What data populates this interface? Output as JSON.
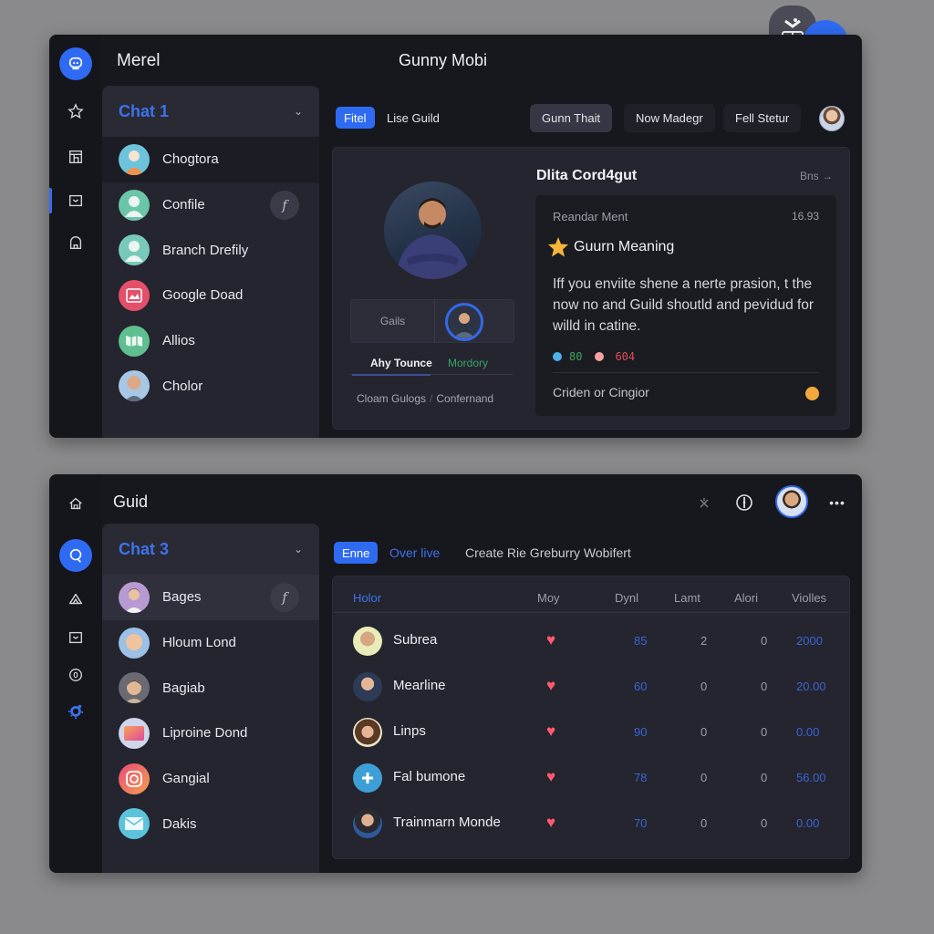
{
  "window1": {
    "title_left": "Merel",
    "title_center": "Gunny Mobi",
    "rail_icons": [
      "app-logo-icon",
      "star-icon",
      "layout-icon",
      "inbox-icon",
      "contacts-icon"
    ],
    "chat_panel": {
      "title": "Chat 1",
      "items": [
        {
          "name": "Chogtora",
          "avatar": "person-orange"
        },
        {
          "name": "Confile",
          "avatar": "person-teal",
          "action": "f"
        },
        {
          "name": "Branch Drefily",
          "avatar": "person-teal"
        },
        {
          "name": "Google Doad",
          "avatar": "image-red"
        },
        {
          "name": "Allios",
          "avatar": "map-green"
        },
        {
          "name": "Cholor",
          "avatar": "photo-man"
        }
      ]
    },
    "tabs": {
      "active": "Fitel",
      "second": "Lise Guild"
    },
    "header_buttons": [
      "Gunn Thait",
      "Now Madegr",
      "Fell Stetur"
    ],
    "profile": {
      "gc_label": "Gails",
      "sub_tab_active": "Ahy Tounce",
      "sub_tab_other": "Mordory",
      "link1": "Cloam Gulogs",
      "link_sep": "/",
      "link2": "Confernand"
    },
    "detail": {
      "title": "Dlita Cord4gut",
      "link": "Bns",
      "link_arrow": "→",
      "card": {
        "label": "Reandar Ment",
        "number": "16.93",
        "heading": "Guurn Meaning",
        "body": "Iff you enviite shene a nerte prasion, t the now no and Guild shoutld and pevidud for willd in catine.",
        "stat1": "80",
        "stat1_color": "#4cb3ea",
        "stat2": "604",
        "stat2_color": "#f4a3a3",
        "footer": "Criden or Cingior",
        "footer_dot_color": "#f2a93b"
      }
    }
  },
  "window2": {
    "title": "Guid",
    "rail_icons": [
      "home-icon",
      "search-chat-icon",
      "triangle-icon",
      "inbox-icon",
      "info-icon",
      "settings-icon"
    ],
    "top_icons": [
      "sparkle-icon",
      "compass-icon",
      "user-avatar",
      "more-icon"
    ],
    "more_label": "•••",
    "chat_panel": {
      "title": "Chat 3",
      "items": [
        {
          "name": "Bages",
          "avatar": "photo-woman",
          "action": "f"
        },
        {
          "name": "Hloum Lond",
          "avatar": "photo-blond"
        },
        {
          "name": "Bagiab",
          "avatar": "photo-woman2"
        },
        {
          "name": "Liproine Dond",
          "avatar": "folder-gradient"
        },
        {
          "name": "Gangial",
          "avatar": "instagram"
        },
        {
          "name": "Dakis",
          "avatar": "mail-cyan"
        }
      ]
    },
    "tabs": {
      "active": "Enne",
      "second": "Over live",
      "third": "Create Rie Greburry Wobifert"
    },
    "table": {
      "columns": [
        "Holor",
        "Moy",
        "Dynl",
        "Lamt",
        "Alori",
        "Violles"
      ],
      "rows": [
        {
          "name": "Subrea",
          "avatar": "photo-man-yellow",
          "liked": true,
          "dynl": "85",
          "lamt": "2",
          "alori": "0",
          "violles": "2000"
        },
        {
          "name": "Mearline",
          "avatar": "photo-man-dark",
          "liked": true,
          "dynl": "60",
          "lamt": "0",
          "alori": "0",
          "violles": "20.00"
        },
        {
          "name": "Linps",
          "avatar": "photo-woman-curly",
          "liked": true,
          "dynl": "90",
          "lamt": "0",
          "alori": "0",
          "violles": "0.00"
        },
        {
          "name": "Fal bumone",
          "avatar": "plus-blue",
          "liked": true,
          "dynl": "78",
          "lamt": "0",
          "alori": "0",
          "violles": "56.00"
        },
        {
          "name": "Trainmarn Monde",
          "avatar": "photo-man-blue",
          "liked": true,
          "dynl": "70",
          "lamt": "0",
          "alori": "0",
          "violles": "0.00"
        }
      ],
      "heart_symbol": "♥"
    }
  },
  "colors": {
    "accent": "#2f6bf2",
    "accent_text": "#3d73ea",
    "window_bg": "#17171e",
    "panel_bg": "#25252f",
    "heart": "#ff5a6e",
    "green": "#34a56a"
  }
}
